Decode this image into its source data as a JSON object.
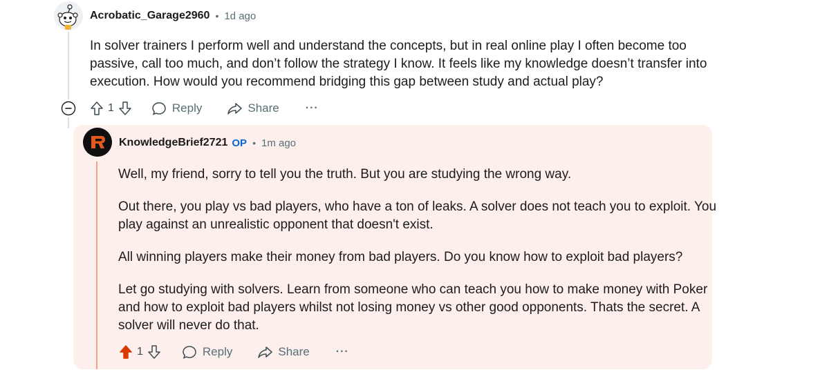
{
  "colors": {
    "op_badge": "#0a66d8",
    "op_background": "#fcefec",
    "op_thread_bar": "#f6a07c",
    "upvote_active": "#d93900",
    "meta_gray": "#576f76"
  },
  "comment": {
    "username": "Acrobatic_Garage2960",
    "separator": "•",
    "time": "1d ago",
    "lines": [
      "In solver trainers I perform well and understand the concepts, but in real online play I often become too",
      "passive, call too much, and don’t follow the strategy I know. It feels like my knowledge doesn’t transfer into",
      "execution. How would you recommend bridging this gap between study and actual play?"
    ],
    "votes": "1",
    "reply_label": "Reply",
    "share_label": "Share",
    "more_label": "···",
    "collapse_icon": "minus-circle-icon"
  },
  "reply": {
    "username": "KnowledgeBrief2721",
    "op_badge": "OP",
    "separator": "•",
    "time": "1m ago",
    "paragraphs": [
      [
        "Well, my friend, sorry to tell you the truth. But you are studying the wrong way."
      ],
      [
        "Out there, you play vs bad players, who have a ton of leaks. A solver does not teach you to exploit. You",
        "play against an unrealistic opponent that doesn't exist."
      ],
      [
        "All winning players make their money from bad players. Do you know how to exploit bad players?"
      ],
      [
        "Let go studying with solvers. Learn from someone who can teach you how to make money with Poker",
        "and how to exploit bad players whilst not losing money vs other good opponents. Thats the secret. A",
        "solver will never do that."
      ]
    ],
    "votes": "1",
    "upvoted": true,
    "reply_label": "Reply",
    "share_label": "Share",
    "more_label": "···"
  }
}
